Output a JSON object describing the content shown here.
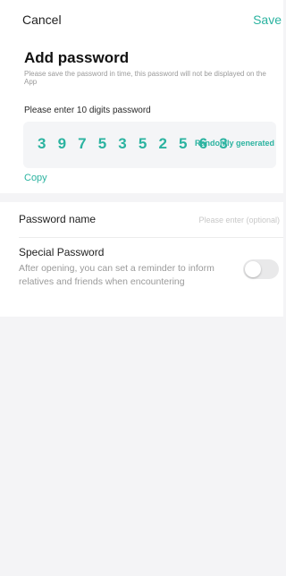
{
  "nav": {
    "cancel_label": "Cancel",
    "save_label": "Save"
  },
  "header": {
    "title": "Add password",
    "subtitle": "Please save the password in time, this password will not be displayed on the App"
  },
  "password": {
    "prompt": "Please enter 10 digits password",
    "digits": "3975352563",
    "random_label": "Randomly generated",
    "copy_label": "Copy"
  },
  "name_field": {
    "label": "Password name",
    "value": "",
    "placeholder": "Please enter (optional)"
  },
  "special": {
    "title": "Special Password",
    "description": "After opening, you can set a reminder to inform relatives and friends when encountering",
    "enabled": false
  },
  "colors": {
    "accent": "#2bb3a0",
    "background": "#f4f4f6",
    "card": "#ffffff"
  }
}
